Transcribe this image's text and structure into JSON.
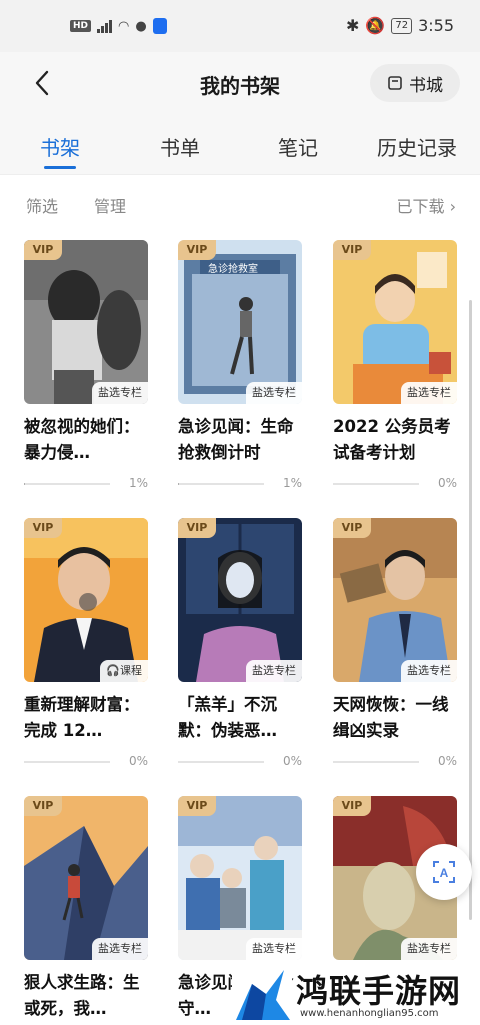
{
  "status_bar": {
    "left_icons": [
      "hd-icon",
      "4g-signal-icon",
      "wifi-icon",
      "wechat-icon",
      "app-shield-icon"
    ],
    "hd_label": "HD",
    "battery": "72",
    "time": "3:55"
  },
  "header": {
    "title": "我的书架",
    "store_label": "书城"
  },
  "tabs": [
    {
      "label": "书架",
      "active": true
    },
    {
      "label": "书单",
      "active": false
    },
    {
      "label": "笔记",
      "active": false
    },
    {
      "label": "历史记录",
      "active": false
    }
  ],
  "toolbar": {
    "filter": "筛选",
    "manage": "管理",
    "downloaded": "已下载"
  },
  "books": [
    {
      "title": "被忽视的她们：暴力侵…",
      "tag": "盐选专栏",
      "vip": "VIP",
      "progress": "1%"
    },
    {
      "title": "急诊见闻：生命抢救倒计时",
      "tag": "盐选专栏",
      "vip": "VIP",
      "progress": "1%",
      "cover_text": "急诊抢救室"
    },
    {
      "title": "2022 公务员考试备考计划",
      "tag": "盐选专栏",
      "vip": "VIP",
      "progress": "0%"
    },
    {
      "title": "重新理解财富：完成 12…",
      "tag": "课程",
      "vip": "VIP",
      "progress": "0%"
    },
    {
      "title": "「羔羊」不沉默：伪装恶…",
      "tag": "盐选专栏",
      "vip": "VIP",
      "progress": "0%"
    },
    {
      "title": "天网恢恢：一线缉凶实录",
      "tag": "盐选专栏",
      "vip": "VIP",
      "progress": "0%"
    },
    {
      "title": "狠人求生路：生或死，我…",
      "tag": "盐选专栏",
      "vip": "VIP",
      "progress": ""
    },
    {
      "title": "急诊见闻：生命守…",
      "tag": "盐选专栏",
      "vip": "VIP",
      "progress": ""
    },
    {
      "title": "",
      "tag": "盐选专栏",
      "vip": "VIP",
      "progress": ""
    }
  ],
  "watermark": {
    "text": "鸿联手游网",
    "url": "www.henanhonglian95.com"
  },
  "colors": {
    "accent": "#1a6fd8",
    "vip_badge": "#e8c48e"
  }
}
